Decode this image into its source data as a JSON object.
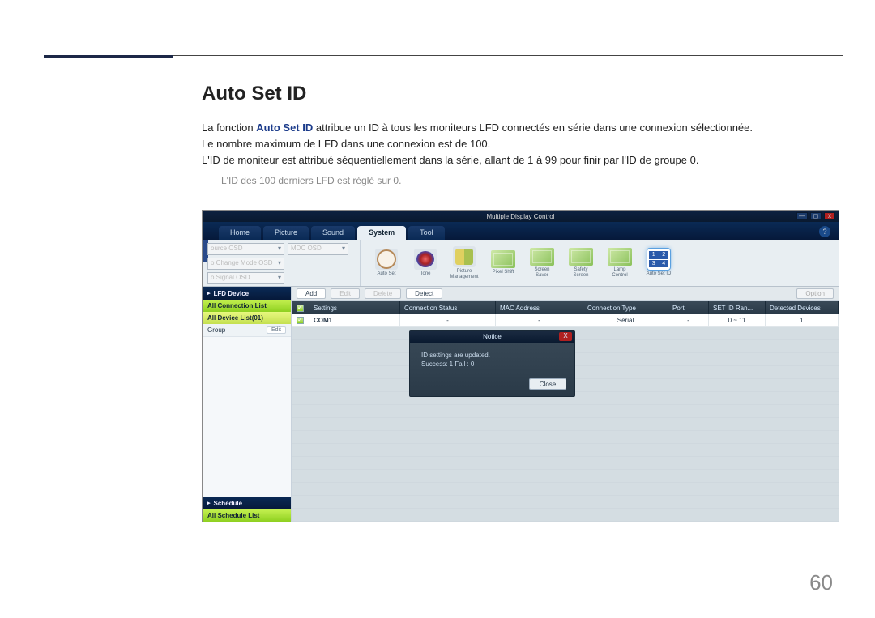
{
  "doc": {
    "heading": "Auto Set ID",
    "para1_prefix": "La fonction ",
    "para1_bold": "Auto Set ID",
    "para1_suffix": " attribue un ID à tous les moniteurs LFD connectés en série dans une connexion sélectionnée.",
    "para2": "Le nombre maximum de LFD dans une connexion est de 100.",
    "para3": "L'ID de moniteur est attribué séquentiellement dans la série, allant de 1 à 99 pour finir par l'ID de groupe 0.",
    "note": "L'ID des 100 derniers LFD est réglé sur 0.",
    "page_number": "60"
  },
  "app": {
    "window_title": "Multiple Display Control",
    "tabs": [
      "Home",
      "Picture",
      "Sound",
      "System",
      "Tool"
    ],
    "active_tab": "System",
    "help_icon": "?",
    "osd": {
      "source_osd": "ource OSD",
      "no_change_osd": "o Change Mode OSD",
      "signal_osd": "o Signal OSD",
      "mdc_osd": "MDC OSD"
    },
    "ribbon_items": [
      "Auto Set",
      "Tone",
      "Picture\nManagement",
      "Pixel Shift",
      "Screen Saver",
      "Safety\nScreen",
      "Lamp Control",
      "Auto Set ID"
    ],
    "sidebar": {
      "hdr1": "LFD Device",
      "all_conn": "All Connection List",
      "all_dev": "All Device List(01)",
      "group": "Group",
      "edit": "Edit",
      "hdr2": "Schedule",
      "all_sched": "All Schedule List"
    },
    "toolbar": {
      "add": "Add",
      "edit": "Edit",
      "delete": "Delete",
      "detect": "Detect",
      "option": "Option"
    },
    "table": {
      "headers": [
        "",
        "Settings",
        "Connection Status",
        "MAC Address",
        "Connection Type",
        "Port",
        "SET ID Ran...",
        "Detected Devices"
      ],
      "row": {
        "settings": "COM1",
        "conn_status": "-",
        "mac": "-",
        "conn_type": "Serial",
        "port": "-",
        "range": "0 ~ 11",
        "detected": "1"
      }
    },
    "modal": {
      "title": "Notice",
      "line1": "ID settings are updated.",
      "line2": "Success: 1  Fail : 0",
      "close": "Close",
      "x": "X"
    },
    "winbtns": {
      "min": "—",
      "max": "◻",
      "close": "x"
    }
  }
}
